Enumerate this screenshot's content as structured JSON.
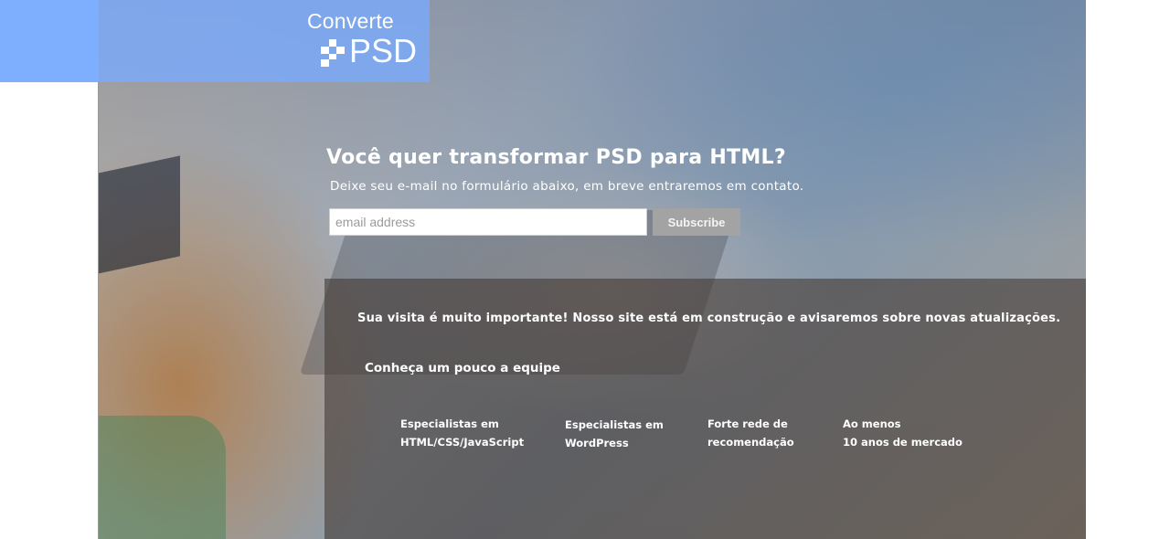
{
  "brand": {
    "logo_line1": "Converte",
    "logo_line2": "PSD"
  },
  "hero": {
    "headline": "Você quer transformar PSD para HTML?",
    "subline": "Deixe seu e-mail no formulário abaixo, em breve entraremos em contato."
  },
  "form": {
    "email_placeholder": "email address",
    "email_value": "",
    "subscribe_label": "Subscribe"
  },
  "info": {
    "notice": "Sua visita é muito importante! Nosso site está em construção e avisaremos sobre novas atualizações.",
    "team_title": "Conheça um pouco a equipe",
    "features": [
      {
        "line1": "Especialistas em",
        "line2": "HTML/CSS/JavaScript"
      },
      {
        "line1": "Especialistas em",
        "line2": "WordPress"
      },
      {
        "line1": "Forte rede de",
        "line2": "recomendação"
      },
      {
        "line1": "Ao menos",
        "line2": "10 anos de mercado"
      }
    ]
  },
  "colors": {
    "logo_bar": "#78aaff",
    "logo_bar_solid": "#94bdfd",
    "button": "#a3a3a3",
    "panel": "#463c37"
  }
}
